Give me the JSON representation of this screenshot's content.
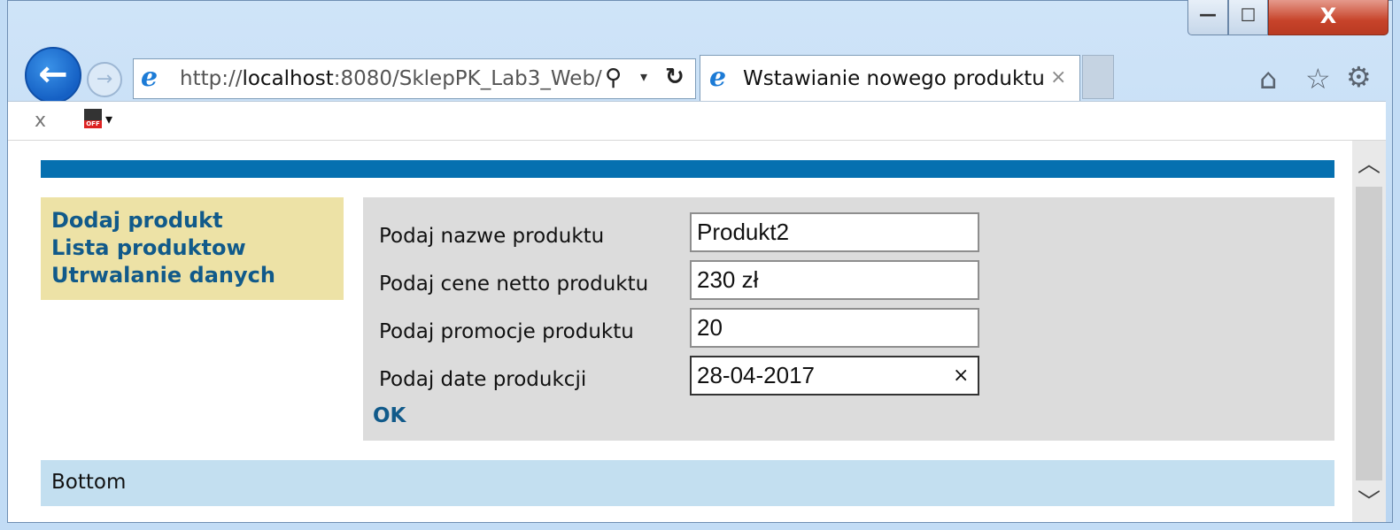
{
  "window": {
    "minimize_glyph": "—",
    "maximize_glyph": "☐",
    "close_glyph": "X"
  },
  "nav": {
    "back_glyph": "←",
    "forward_glyph": "→",
    "address_prefix": "http://",
    "address_host": "localhost",
    "address_rest": ":8080/SklepPK_Lab3_Web/",
    "search_glyph": "⚲",
    "dropdown_glyph": "▾",
    "refresh_glyph": "↻"
  },
  "tab": {
    "title": "Wstawianie nowego produktu",
    "close_glyph": "×"
  },
  "toolbar": {
    "home_glyph": "⌂",
    "favorites_glyph": "☆",
    "settings_glyph": "⚙"
  },
  "commandbar": {
    "close_glyph": "x",
    "addon_badge": "OFF",
    "dropdown_glyph": "▾"
  },
  "menu": {
    "items": [
      "Dodaj produkt",
      "Lista produktow",
      "Utrwalanie danych"
    ]
  },
  "form": {
    "fields": [
      {
        "label": "Podaj nazwe produktu",
        "value": "Produkt2"
      },
      {
        "label": "Podaj cene netto produktu",
        "value": "230 zł"
      },
      {
        "label": "Podaj promocje produktu",
        "value": "20"
      },
      {
        "label": "Podaj date produkcji",
        "value": "28-04-2017"
      }
    ],
    "clear_glyph": "×",
    "submit_label": "OK"
  },
  "footer": {
    "text": "Bottom"
  },
  "scrollbar": {
    "up_glyph": "︿",
    "down_glyph": "﹀"
  },
  "colors": {
    "topbar": "#0670b0",
    "menu_bg": "#ede2a6",
    "link": "#115a8a",
    "form_bg": "#dcdcdc",
    "footer_bg": "#c3dff0"
  }
}
